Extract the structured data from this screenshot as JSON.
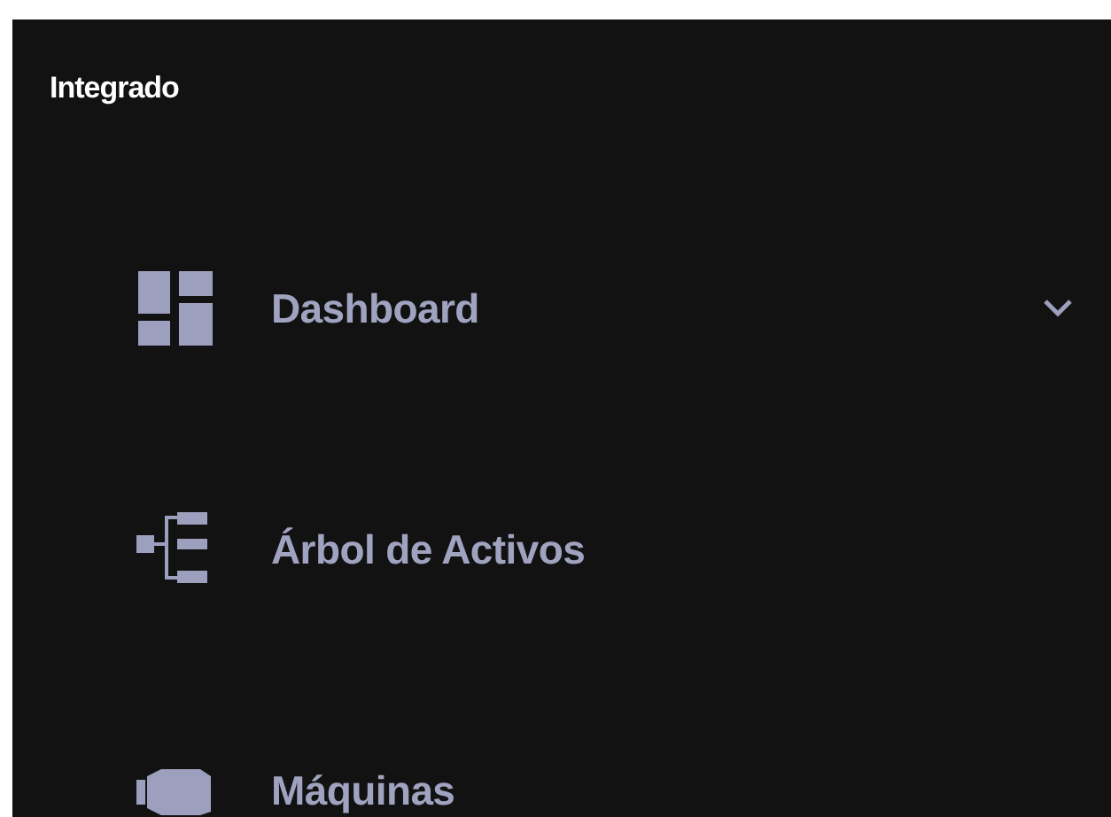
{
  "sidebar": {
    "title": "Integrado",
    "items": [
      {
        "label": "Dashboard",
        "kind": "group",
        "expanded": false
      },
      {
        "label": "Árbol de Activos",
        "kind": "link"
      },
      {
        "label": "Máquinas",
        "kind": "link"
      }
    ]
  }
}
